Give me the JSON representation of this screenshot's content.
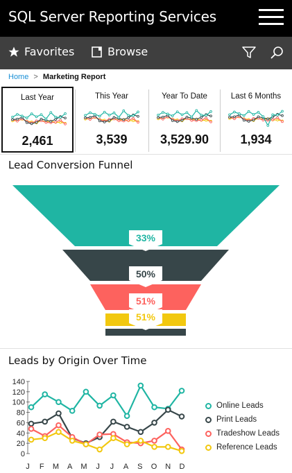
{
  "app": {
    "title": "SQL Server Reporting Services"
  },
  "nav": {
    "favorites_label": "Favorites",
    "browse_label": "Browse"
  },
  "breadcrumb": {
    "home": "Home",
    "separator": ">",
    "current": "Marketing Report"
  },
  "kpis": [
    {
      "label": "Last Year",
      "value": "2,461",
      "selected": true
    },
    {
      "label": "This Year",
      "value": "3,539",
      "selected": false
    },
    {
      "label": "Year To Date",
      "value": "3,529.90",
      "selected": false
    },
    {
      "label": "Last 6 Months",
      "value": "1,934",
      "selected": false
    }
  ],
  "funnel": {
    "title": "Lead Conversion Funnel",
    "stages": [
      {
        "label": "33%",
        "color": "#1fb5a3"
      },
      {
        "label": "50%",
        "color": "#374649"
      },
      {
        "label": "51%",
        "color": "#fd625e"
      },
      {
        "label": "51%",
        "color": "#f2c80f"
      }
    ]
  },
  "chart_data": {
    "type": "line",
    "title": "Leads by Origin Over Time",
    "categories": [
      "J",
      "F",
      "M",
      "A",
      "M",
      "J",
      "J",
      "A",
      "S",
      "O",
      "N",
      "D"
    ],
    "ylim": [
      0,
      140
    ],
    "yticks": [
      0,
      20,
      40,
      60,
      80,
      100,
      120,
      140
    ],
    "legend_position": "right",
    "series": [
      {
        "name": "Online Leads",
        "color": "#1fb5a3",
        "values": [
          90,
          115,
          100,
          83,
          120,
          93,
          113,
          73,
          132,
          90,
          87,
          122
        ]
      },
      {
        "name": "Print Leads",
        "color": "#374649",
        "values": [
          58,
          62,
          78,
          30,
          20,
          32,
          62,
          52,
          42,
          60,
          85,
          72
        ]
      },
      {
        "name": "Tradeshow Leads",
        "color": "#fd625e",
        "values": [
          48,
          34,
          55,
          32,
          18,
          37,
          38,
          22,
          20,
          25,
          44,
          8
        ]
      },
      {
        "name": "Reference Leads",
        "color": "#f2c80f",
        "values": [
          27,
          30,
          42,
          25,
          18,
          8,
          30,
          18,
          25,
          13,
          13,
          5
        ]
      }
    ]
  }
}
